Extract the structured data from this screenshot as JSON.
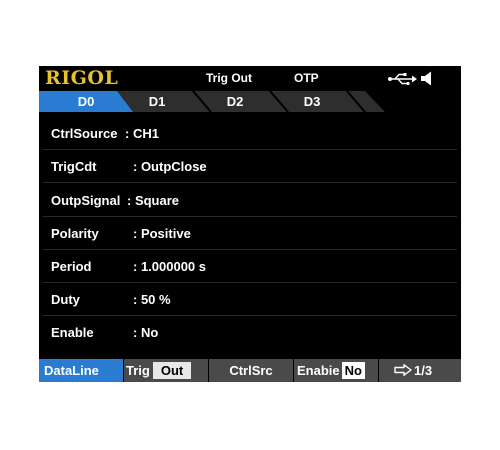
{
  "status_bar": {
    "brand": "RIGOL",
    "mode": "Trig Out",
    "protection": "OTP",
    "icons": [
      "usb-icon",
      "speaker-icon"
    ],
    "brand_color": "#e6c22e"
  },
  "tabs": [
    {
      "label": "D0",
      "selected": true
    },
    {
      "label": "D1",
      "selected": false
    },
    {
      "label": "D2",
      "selected": false
    },
    {
      "label": "D3",
      "selected": false
    }
  ],
  "params": [
    {
      "label": "CtrlSource",
      "value": ": CH1"
    },
    {
      "label": "TrigCdt",
      "value": ": OutpClose"
    },
    {
      "label": "OutpSignal",
      "value": ": Square"
    },
    {
      "label": "Polarity",
      "value": ": Positive"
    },
    {
      "label": "Period",
      "value": ": 1.000000 s"
    },
    {
      "label": "Duty",
      "value": ": 50 %"
    },
    {
      "label": "Enable",
      "value": ": No"
    }
  ],
  "softkeys": {
    "dataline": "DataLine",
    "trig_label": "Trig",
    "trig_value": "Out",
    "ctrlsrc": "CtrlSrc",
    "enable_label": "Enabie",
    "enable_value": "No",
    "page": "1/3",
    "page_icon": "arrow-right-icon",
    "active_color": "#2a7bd2"
  }
}
